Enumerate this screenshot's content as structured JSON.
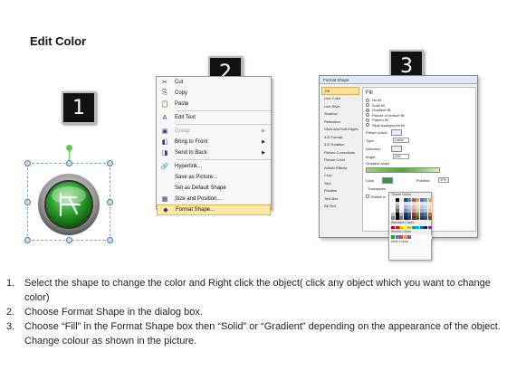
{
  "title": "Edit Color",
  "badges": [
    "1",
    "2",
    "3"
  ],
  "context_menu": {
    "items": [
      {
        "label": "Cut",
        "icon": "scissors-icon",
        "glyph": "✂",
        "disabled": false
      },
      {
        "label": "Copy",
        "icon": "copy-icon",
        "glyph": "⎘",
        "disabled": false
      },
      {
        "label": "Paste",
        "icon": "paste-icon",
        "glyph": "📋",
        "disabled": false
      },
      {
        "label": "Edit Text",
        "icon": "edit-text-icon",
        "glyph": "A",
        "disabled": false,
        "sep_before": true
      },
      {
        "label": "Group",
        "icon": "group-icon",
        "glyph": "▣",
        "disabled": true,
        "arrow": true,
        "sep_before": true
      },
      {
        "label": "Bring to Front",
        "icon": "bring-front-icon",
        "glyph": "◧",
        "disabled": false,
        "arrow": true
      },
      {
        "label": "Send to Back",
        "icon": "send-back-icon",
        "glyph": "◨",
        "disabled": false,
        "arrow": true
      },
      {
        "label": "Hyperlink...",
        "icon": "hyperlink-icon",
        "glyph": "🔗",
        "disabled": false,
        "sep_before": true
      },
      {
        "label": "Save as Picture...",
        "icon": "",
        "glyph": "",
        "disabled": false
      },
      {
        "label": "Set as Default Shape",
        "icon": "",
        "glyph": "",
        "disabled": false
      },
      {
        "label": "Size and Position...",
        "icon": "size-position-icon",
        "glyph": "▦",
        "disabled": false
      },
      {
        "label": "Format Shape...",
        "icon": "format-shape-icon",
        "glyph": "◆",
        "disabled": false,
        "active": true
      }
    ]
  },
  "dialog": {
    "title": "Format Shape",
    "left_items": [
      "Fill",
      "Line Color",
      "Line Style",
      "Shadow",
      "Reflection",
      "Glow and Soft Edges",
      "3-D Format",
      "3-D Rotation",
      "Picture Corrections",
      "Picture Color",
      "Artistic Effects",
      "Crop",
      "Size",
      "Position",
      "Text Box",
      "Alt Text"
    ],
    "fill_heading": "Fill",
    "fill_options": [
      {
        "label": "No fill",
        "on": false
      },
      {
        "label": "Solid fill",
        "on": false
      },
      {
        "label": "Gradient fill",
        "on": true
      },
      {
        "label": "Picture or texture fill",
        "on": false
      },
      {
        "label": "Pattern fill",
        "on": false
      },
      {
        "label": "Slide background fill",
        "on": false
      }
    ],
    "preset_label": "Preset colors:",
    "type_label": "Type:",
    "type_value": "Linear",
    "direction_label": "Direction:",
    "angle_label": "Angle:",
    "angle_value": "225°",
    "stops_label": "Gradient stops",
    "color_label": "Color",
    "position_label": "Position:",
    "position_value": "37%",
    "transparency_label": "Transparen",
    "rotate_label": "Rotate w"
  },
  "color_picker": {
    "theme_label": "Theme Colors",
    "standard_label": "Standard Colors",
    "recent_label": "Recent Colors",
    "more_label": "More Colors..."
  },
  "instructions": [
    {
      "n": "1.",
      "text": "Select the shape to change the color and Right click the object( click any object which you want to change color)"
    },
    {
      "n": "2.",
      "text": "Choose Format Shape in the dialog box."
    },
    {
      "n": "3.",
      "text": "Choose “Fill” in the Format Shape box then “Solid” or “Gradient” depending on the appearance of the object. Change colour as shown in the picture."
    }
  ],
  "colors": {
    "shape_green": "#2aa02a",
    "badge_bg": "#111111",
    "menu_highlight": "#fde9a6"
  }
}
